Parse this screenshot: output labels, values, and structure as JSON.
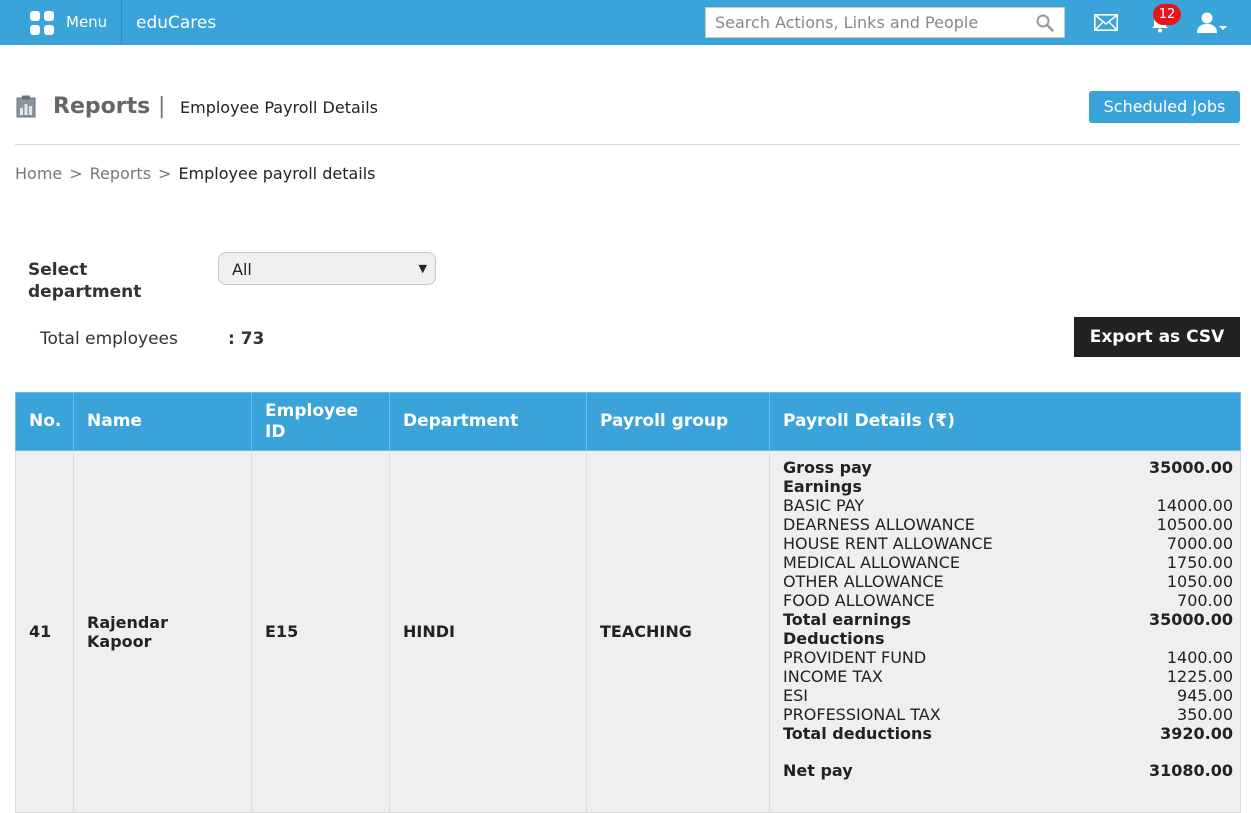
{
  "topbar": {
    "menu_label": "Menu",
    "brand": "eduCares",
    "search_placeholder": "Search Actions, Links and People",
    "notification_count": "12"
  },
  "header": {
    "title": "Reports",
    "separator": "|",
    "subtitle": "Employee Payroll Details",
    "scheduled_jobs_label": "Scheduled Jobs"
  },
  "breadcrumb": {
    "items": [
      "Home",
      "Reports",
      "Employee payroll details"
    ],
    "separator": ">"
  },
  "filter": {
    "department_label": "Select department",
    "department_value": "All",
    "total_label": "Total employees",
    "total_value": ": 73",
    "export_label": "Export as CSV"
  },
  "table": {
    "columns": [
      "No.",
      "Name",
      "Employee ID",
      "Department",
      "Payroll group",
      "Payroll Details (₹)"
    ],
    "row": {
      "no": "41",
      "name": "Rajendar Kapoor",
      "employee_id": "E15",
      "department": "HINDI",
      "payroll_group": "TEACHING",
      "details": {
        "gross_label": "Gross pay",
        "gross_value": "35000.00",
        "earnings_label": "Earnings",
        "earnings": [
          {
            "label": "BASIC PAY",
            "value": "14000.00"
          },
          {
            "label": "DEARNESS ALLOWANCE",
            "value": "10500.00"
          },
          {
            "label": "HOUSE RENT ALLOWANCE",
            "value": "7000.00"
          },
          {
            "label": "MEDICAL ALLOWANCE",
            "value": "1750.00"
          },
          {
            "label": "OTHER ALLOWANCE",
            "value": "1050.00"
          },
          {
            "label": "FOOD ALLOWANCE",
            "value": "700.00"
          }
        ],
        "total_earnings_label": "Total earnings",
        "total_earnings_value": "35000.00",
        "deductions_label": "Deductions",
        "deductions": [
          {
            "label": "PROVIDENT FUND",
            "value": "1400.00"
          },
          {
            "label": "INCOME TAX",
            "value": "1225.00"
          },
          {
            "label": "ESI",
            "value": "945.00"
          },
          {
            "label": "PROFESSIONAL TAX",
            "value": "350.00"
          }
        ],
        "total_deductions_label": "Total deductions",
        "total_deductions_value": "3920.00",
        "net_label": "Net pay",
        "net_value": "31080.00"
      }
    }
  },
  "colors": {
    "accent": "#3aa3d9",
    "badge": "#e8141c",
    "dark_button": "#222222"
  },
  "icons": [
    "grid-menu-icon",
    "search-icon",
    "mail-icon",
    "bell-icon",
    "user-icon",
    "reports-icon"
  ]
}
